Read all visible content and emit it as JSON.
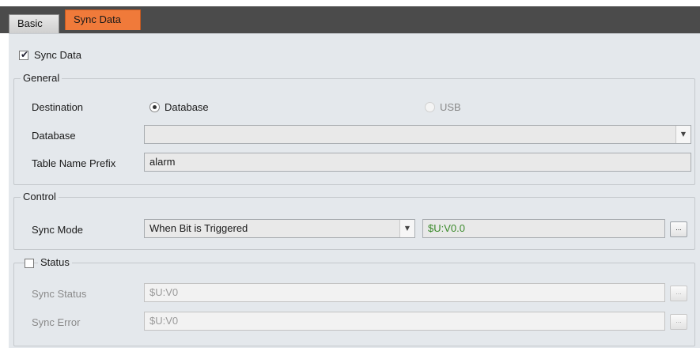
{
  "tabs": [
    {
      "label": "Basic"
    },
    {
      "label": "Sync Data"
    }
  ],
  "sync_data_checkbox": {
    "label": "Sync Data",
    "checked": true
  },
  "general": {
    "legend": "General",
    "destination_label": "Destination",
    "destination_options": [
      {
        "label": "Database",
        "selected": true,
        "enabled": true
      },
      {
        "label": "USB",
        "selected": false,
        "enabled": false
      }
    ],
    "database_label": "Database",
    "database_value": "",
    "table_prefix_label": "Table Name Prefix",
    "table_prefix_value": "alarm"
  },
  "control": {
    "legend": "Control",
    "sync_mode_label": "Sync Mode",
    "sync_mode_value": "When Bit is Triggered",
    "trigger_address": "$U:V0.0",
    "browse_label": "..."
  },
  "status": {
    "legend": "Status",
    "checked": false,
    "sync_status_label": "Sync Status",
    "sync_status_value": "$U:V0",
    "sync_error_label": "Sync Error",
    "sync_error_value": "$U:V0",
    "browse_label": "..."
  },
  "colors": {
    "active_tab": "#f07a3a",
    "tab_strip": "#4b4b4b",
    "panel_bg": "#e4e8ec",
    "address_text": "#3a8a2a"
  },
  "icons": {
    "check": "✔",
    "dropdown": "▼"
  }
}
